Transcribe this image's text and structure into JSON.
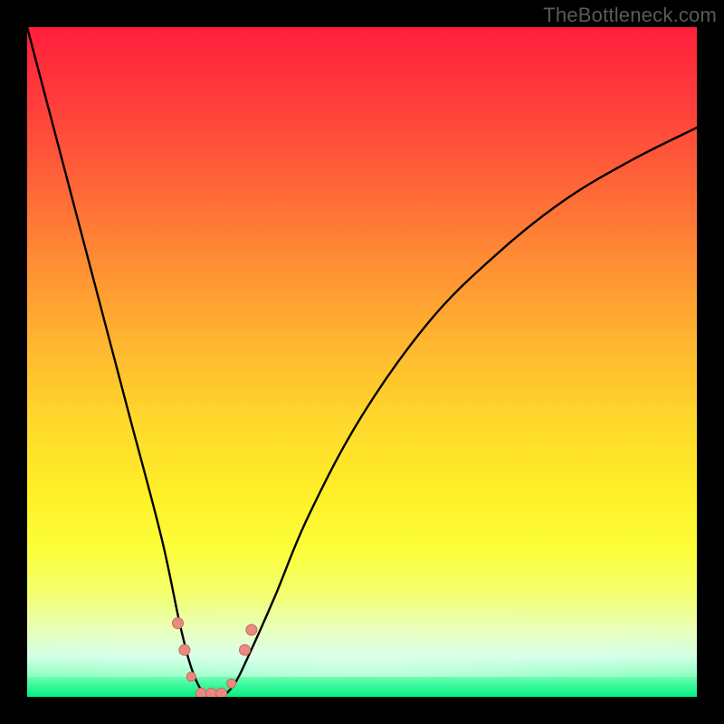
{
  "watermark": "TheBottleneck.com",
  "colors": {
    "frame": "#000000",
    "curve_stroke": "#000000",
    "marker_fill": "#e88a80",
    "marker_stroke": "#c96a5e",
    "gradient_top": "#ff1e3c",
    "gradient_bottom": "#00f080"
  },
  "chart_data": {
    "type": "line",
    "title": "",
    "xlabel": "",
    "ylabel": "",
    "xlim": [
      0,
      100
    ],
    "ylim": [
      0,
      100
    ],
    "grid": false,
    "legend": false,
    "note": "V-shaped bottleneck curve. x is relative component capability (0–100), y is bottleneck percent (0 = balanced/green, 100 = severe/red). Minimum around x≈27 with y≈0.",
    "series": [
      {
        "name": "bottleneck_curve",
        "x": [
          0,
          5,
          10,
          15,
          20,
          23,
          25,
          27,
          29,
          31,
          33,
          37,
          42,
          50,
          60,
          70,
          80,
          90,
          100
        ],
        "y": [
          100,
          81,
          62,
          43,
          24,
          10,
          3,
          0,
          0,
          2,
          6,
          15,
          27,
          42,
          56,
          66,
          74,
          80,
          85
        ]
      }
    ],
    "markers": [
      {
        "x": 22.5,
        "y": 11,
        "r": 6
      },
      {
        "x": 23.5,
        "y": 7,
        "r": 6
      },
      {
        "x": 24.5,
        "y": 3,
        "r": 5
      },
      {
        "x": 26.0,
        "y": 0.5,
        "r": 6
      },
      {
        "x": 27.5,
        "y": 0.5,
        "r": 6
      },
      {
        "x": 29.0,
        "y": 0.5,
        "r": 6
      },
      {
        "x": 30.5,
        "y": 2,
        "r": 5
      },
      {
        "x": 32.5,
        "y": 7,
        "r": 6
      },
      {
        "x": 33.5,
        "y": 10,
        "r": 6
      }
    ]
  }
}
